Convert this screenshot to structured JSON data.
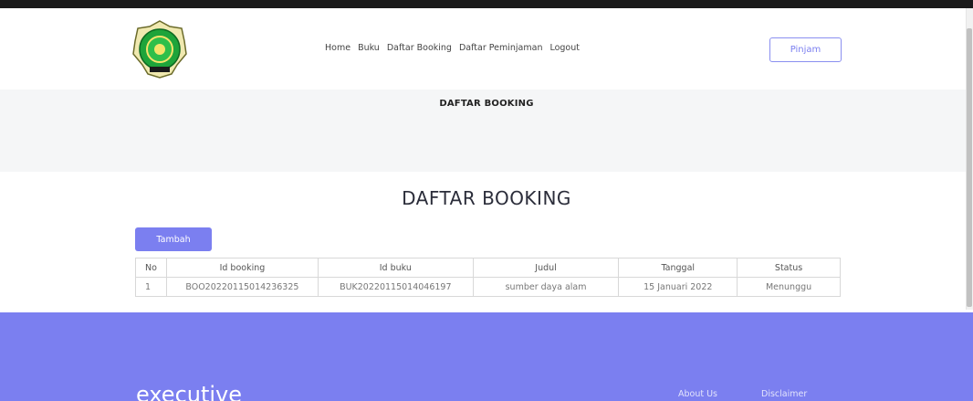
{
  "nav": {
    "links": [
      "Home",
      "Buku",
      "Daftar Booking",
      "Daftar Peminjaman",
      "Logout"
    ],
    "pinjam_label": "Pinjam"
  },
  "band": {
    "title": "DAFTAR BOOKING"
  },
  "main": {
    "heading": "DAFTAR BOOKING",
    "add_label": "Tambah"
  },
  "table": {
    "headers": [
      "No",
      "Id booking",
      "Id buku",
      "Judul",
      "Tanggal",
      "Status"
    ],
    "rows": [
      [
        "1",
        "BOO20220115014236325",
        "BUK20220115014046197",
        "sumber daya alam",
        "15 Januari 2022",
        "Menunggu"
      ]
    ]
  },
  "footer": {
    "brand": "executive",
    "links": [
      "About Us",
      "Disclaimer"
    ]
  },
  "colors": {
    "accent": "#7b7ff0",
    "band": "#f5f6f7"
  }
}
